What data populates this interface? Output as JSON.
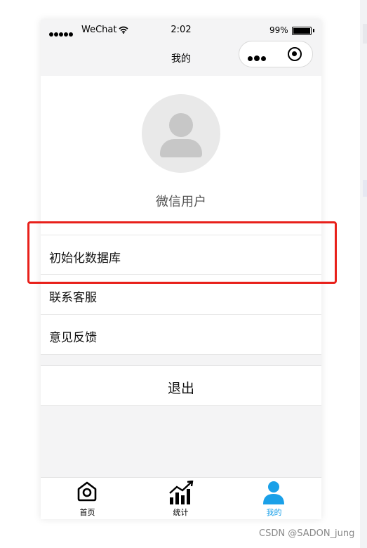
{
  "status_bar": {
    "carrier": "WeChat",
    "time": "2:02",
    "battery": "99%"
  },
  "navbar": {
    "title": "我的"
  },
  "profile": {
    "nickname": "微信用户"
  },
  "menu": {
    "items": [
      {
        "label": "初始化数据库"
      },
      {
        "label": "联系客服"
      },
      {
        "label": "意见反馈"
      }
    ]
  },
  "logout": {
    "label": "退出"
  },
  "tabbar": {
    "items": [
      {
        "label": "首页",
        "icon": "home-icon"
      },
      {
        "label": "统计",
        "icon": "stats-icon"
      },
      {
        "label": "我的",
        "icon": "user-icon"
      }
    ],
    "active_color": "#1aa0e8"
  },
  "annotation": {
    "highlight_color": "#e8201a"
  },
  "watermark": {
    "text": "CSDN @SADON_jung"
  }
}
